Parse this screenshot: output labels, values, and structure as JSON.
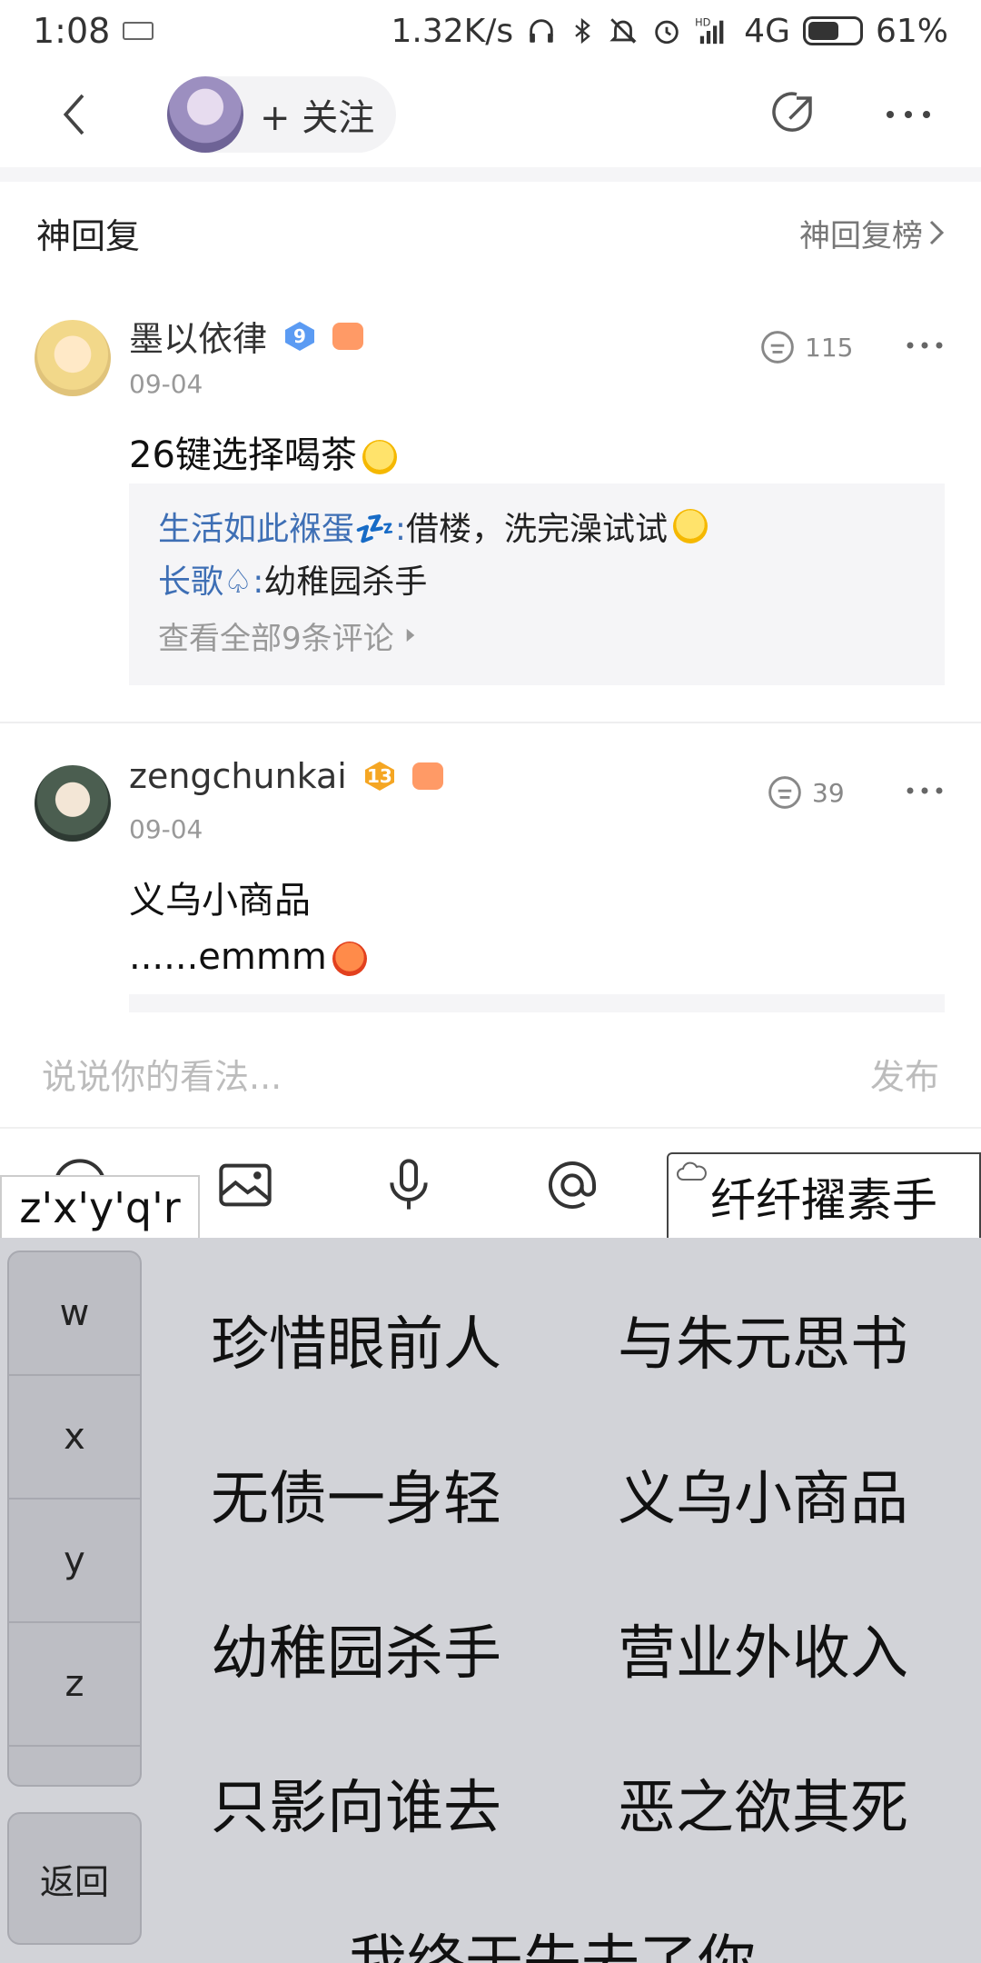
{
  "status_bar": {
    "time": "1:08",
    "network_speed": "1.32K/s",
    "network": "4G",
    "battery": "61%",
    "battery_level": 0.61
  },
  "nav": {
    "follow_label": "+ 关注"
  },
  "section": {
    "title": "神回复",
    "link": "神回复榜"
  },
  "comments": [
    {
      "user": "墨以依律",
      "level": "9",
      "date": "09-04",
      "likes": "115",
      "text": "26键选择喝茶",
      "replies": [
        {
          "who": "生活如此褓蛋💤:",
          "text": " 借楼，洗完澡试试"
        },
        {
          "who": "长歌♤:",
          "text": " 幼稚园杀手"
        }
      ],
      "view_all": "查看全部9条评论"
    },
    {
      "user": "zengchunkai",
      "level": "13",
      "date": "09-04",
      "likes": "39",
      "text_line1": "义乌小商品",
      "text_line2": "......emmm"
    }
  ],
  "input": {
    "placeholder": "说说你的看法...",
    "send": "发布"
  },
  "ime": {
    "pinyin": "z'x'y'q'r",
    "cloud_suggestion": "纤纤擢素手",
    "letters": [
      "w",
      "x",
      "y",
      "z"
    ],
    "back_label": "返回",
    "candidates": [
      "珍惜眼前人",
      "与朱元思书",
      "无债一身轻",
      "义乌小商品",
      "幼稚园杀手",
      "营业外收入",
      "只影向谁去",
      "恶之欲其死",
      "我终于失去了你"
    ]
  },
  "colors": {
    "link_blue": "#3e6fb5",
    "keyboard_bg": "#d2d3d8",
    "level9_badge": "#5b9bf3",
    "level13_badge": "#f5a623"
  }
}
